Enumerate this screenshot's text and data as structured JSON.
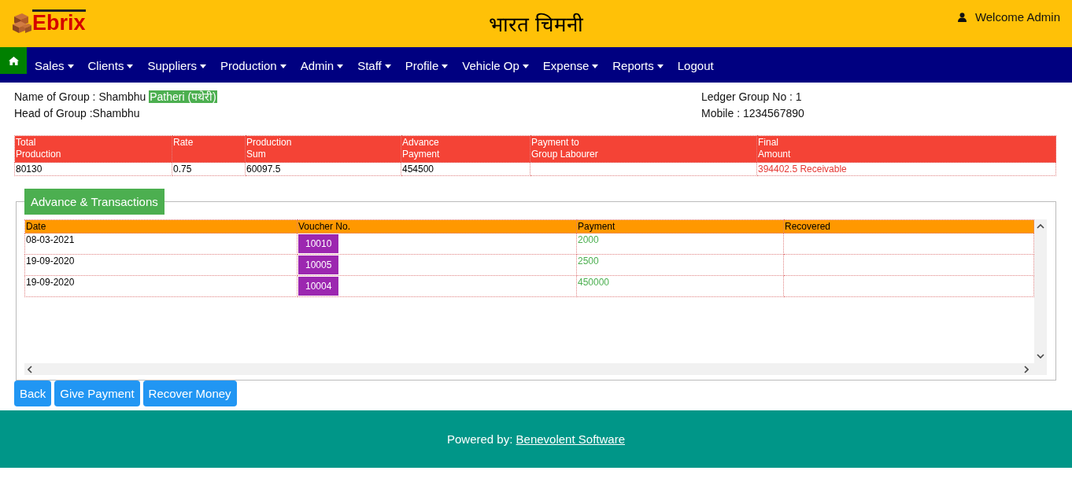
{
  "header": {
    "logo": "Ebrix",
    "title": "भारत चिमनी",
    "welcome": "Welcome Admin"
  },
  "nav": [
    {
      "label": "Sales",
      "kind": "dropdown"
    },
    {
      "label": "Clients",
      "kind": "dropdown"
    },
    {
      "label": "Suppliers",
      "kind": "dropdown"
    },
    {
      "label": "Production",
      "kind": "dropdown"
    },
    {
      "label": "Admin",
      "kind": "dropdown"
    },
    {
      "label": "Staff",
      "kind": "dropdown"
    },
    {
      "label": "Profile",
      "kind": "dropdown"
    },
    {
      "label": "Vehicle Op",
      "kind": "dropdown"
    },
    {
      "label": "Expense",
      "kind": "dropdown"
    },
    {
      "label": "Reports",
      "kind": "dropdown"
    },
    {
      "label": "Logout",
      "kind": "link"
    }
  ],
  "info": {
    "name_label": "Name of Group : Shambhu",
    "name_badge": "Patheri (पथेरी)",
    "head": "Head of Group :Shambhu",
    "ledger": "Ledger Group No : 1",
    "mobile": "Mobile : 1234567890"
  },
  "summary": {
    "columns": [
      "Total\nProduction",
      "Rate",
      "Production\nSum",
      "Advance\nPayment",
      "Payment to\nGroup Labourer",
      "Final\nAmount"
    ],
    "row": {
      "total_production": "80130",
      "rate": "0.75",
      "production_sum": "60097.5",
      "advance_payment": "454500",
      "final_amount": "394402.5 Receivable"
    }
  },
  "transactions": {
    "legend": "Advance & Transactions",
    "columns": [
      "Date",
      "Voucher No.",
      "Payment",
      "Recovered"
    ],
    "rows": [
      {
        "date": "08-03-2021",
        "voucher": "10010",
        "payment": "2000"
      },
      {
        "date": "19-09-2020",
        "voucher": "10005",
        "payment": "2500"
      },
      {
        "date": "19-09-2020",
        "voucher": "10004",
        "payment": "450000"
      }
    ]
  },
  "buttons": [
    "Back",
    "Give Payment",
    "Recover Money"
  ],
  "footer": {
    "prefix": "Powered by:",
    "link": "Benevolent Software"
  }
}
